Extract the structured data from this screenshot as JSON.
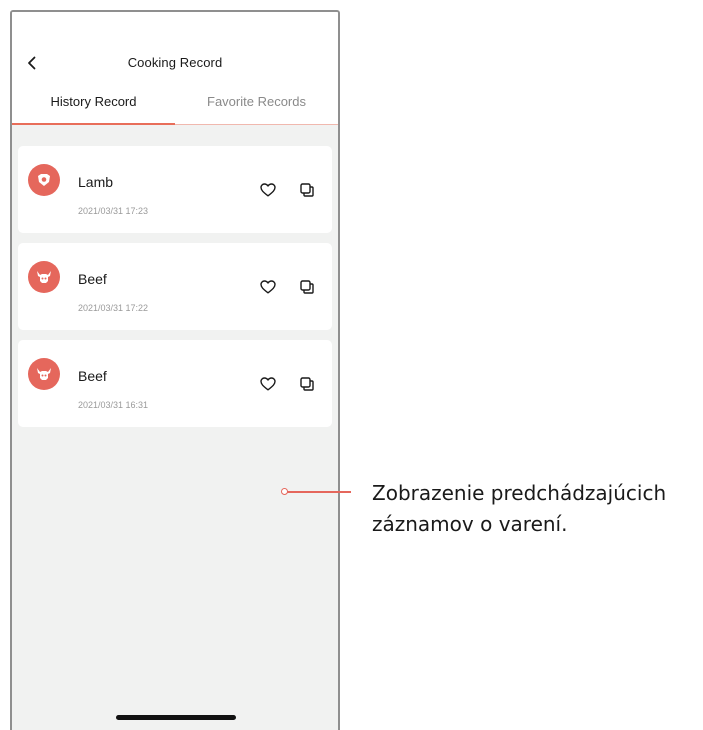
{
  "header": {
    "back_icon": "chevron-left-icon",
    "title": "Cooking Record"
  },
  "tabs": [
    {
      "label": "History Record",
      "active": true
    },
    {
      "label": "Favorite Records",
      "active": false
    }
  ],
  "records": [
    {
      "name": "Lamb",
      "timestamp": "2021/03/31 17:23",
      "icon": "lamb-icon"
    },
    {
      "name": "Beef",
      "timestamp": "2021/03/31 17:22",
      "icon": "beef-icon"
    },
    {
      "name": "Beef",
      "timestamp": "2021/03/31 16:31",
      "icon": "beef-icon"
    }
  ],
  "card_actions": {
    "favorite_icon": "heart-icon",
    "copy_icon": "copy-icon"
  },
  "callout": {
    "text": "Zobrazenie predchádzajúcich\nzáznamov o varení."
  },
  "colors": {
    "accent": "#e86e5a",
    "icon_bg": "#e5675c",
    "background": "#f1f2f1"
  }
}
